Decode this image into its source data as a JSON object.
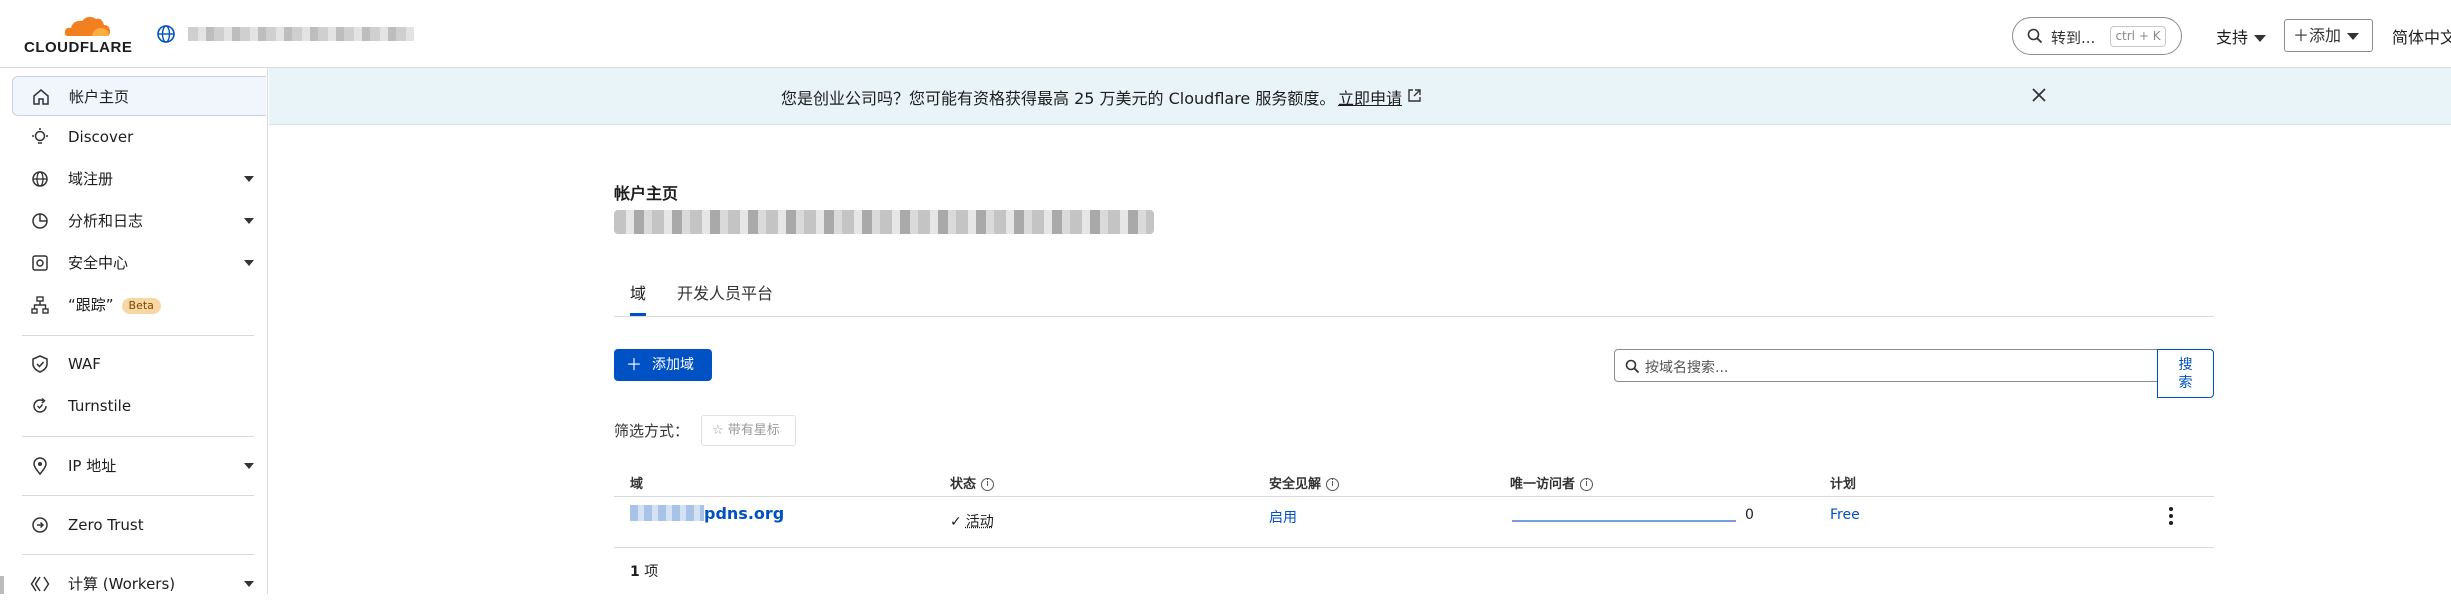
{
  "header": {
    "logo_text": "CLOUDFLARE",
    "search_label": "转到...",
    "search_shortcut": "ctrl + K",
    "support_label": "支持",
    "add_label": "添加",
    "language_label": "简体中文"
  },
  "sidebar": {
    "items": [
      {
        "label": "帐户主页",
        "icon": "home-icon"
      },
      {
        "label": "Discover",
        "icon": "lightbulb-icon"
      },
      {
        "label": "域注册",
        "icon": "globe-icon"
      },
      {
        "label": "分析和日志",
        "icon": "chart-clock-icon"
      },
      {
        "label": "安全中心",
        "icon": "shield-center-icon"
      },
      {
        "label": "“跟踪”",
        "icon": "trace-icon",
        "badge": "Beta"
      },
      {
        "label": "WAF",
        "icon": "waf-shield-icon"
      },
      {
        "label": "Turnstile",
        "icon": "turnstile-icon"
      },
      {
        "label": "IP 地址",
        "icon": "location-pin-icon"
      },
      {
        "label": "Zero Trust",
        "icon": "zero-trust-icon"
      },
      {
        "label": "计算 (Workers)",
        "icon": "workers-icon"
      }
    ]
  },
  "banner": {
    "text": "您是创业公司吗？您可能有资格获得最高 25 万美元的 Cloudflare 服务额度。",
    "link_label": "立即申请"
  },
  "main": {
    "title": "帐户主页",
    "tabs": [
      "域",
      "开发人员平台"
    ],
    "add_domain_label": "添加域",
    "search_placeholder": "按域名搜索...",
    "search_button": "搜索",
    "filter_label": "筛选方式：",
    "starred_label": "带有星标",
    "table": {
      "headers": [
        "域",
        "状态",
        "安全见解",
        "唯一访问者",
        "计划"
      ],
      "rows": [
        {
          "domain": "pdns.org",
          "status": "活动",
          "insights": "启用",
          "visitors": "0",
          "plan": "Free"
        }
      ],
      "count": "1",
      "count_unit": "项"
    }
  },
  "colors": {
    "accent": "#0051c3",
    "brand_orange": "#f38020",
    "banner_bg": "#e9f4f9"
  }
}
